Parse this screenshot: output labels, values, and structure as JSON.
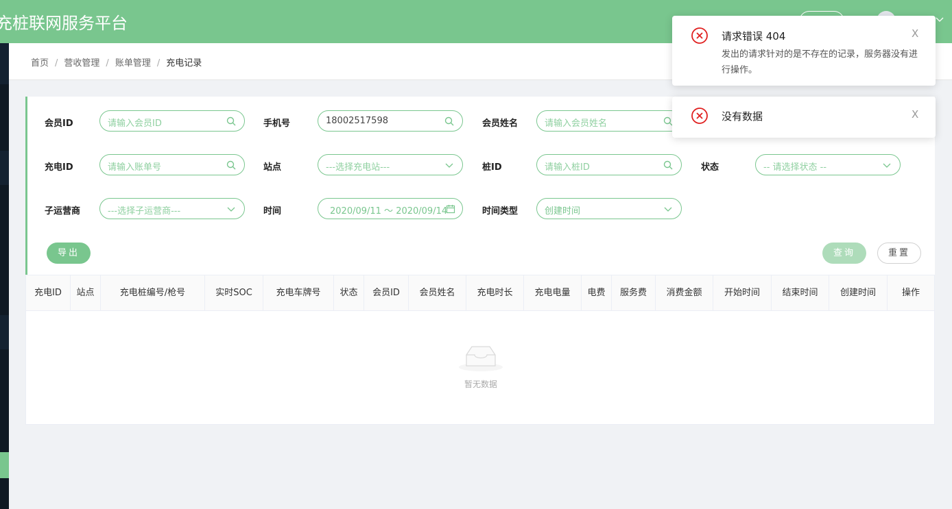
{
  "header": {
    "title": "充桩联网服务平台"
  },
  "breadcrumb": {
    "items": [
      "首页",
      "营收管理",
      "账单管理",
      "充电记录"
    ],
    "separator": "/"
  },
  "filters": {
    "member_id": {
      "label": "会员ID",
      "placeholder": "请输入会员ID"
    },
    "phone": {
      "label": "手机号",
      "value": "18002517598"
    },
    "member_name": {
      "label": "会员姓名",
      "placeholder": "请输入会员姓名"
    },
    "charge_id": {
      "label": "充电ID",
      "placeholder": "请输入账单号"
    },
    "station": {
      "label": "站点",
      "placeholder": "---选择充电站---"
    },
    "pile_id": {
      "label": "桩ID",
      "placeholder": "请输入桩ID"
    },
    "status": {
      "label": "状态",
      "placeholder": "-- 请选择状态 --"
    },
    "sub_operator": {
      "label": "子运营商",
      "placeholder": "---选择子运营商---"
    },
    "time": {
      "label": "时间",
      "value": "2020/09/11 ～ 2020/09/14"
    },
    "time_type": {
      "label": "时间类型",
      "value": "创建时间"
    }
  },
  "buttons": {
    "export": "导出",
    "query": "查询",
    "reset": "重置"
  },
  "table": {
    "columns": [
      "充电ID",
      "站点",
      "充电桩编号/枪号",
      "实时SOC",
      "充电车牌号",
      "状态",
      "会员ID",
      "会员姓名",
      "充电时长",
      "充电电量",
      "电费",
      "服务费",
      "消费金额",
      "开始时间",
      "结束时间",
      "创建时间",
      "操作"
    ],
    "rows": [],
    "empty_text": "暂无数据"
  },
  "notifications": [
    {
      "title": "请求错误 404",
      "body": "发出的请求针对的是不存在的记录，服务器没有进行操作。",
      "close": "X"
    },
    {
      "title": "没有数据",
      "close": "X"
    }
  ],
  "colors": {
    "primary": "#79c68e",
    "error": "#e02020",
    "sidebar": "#0f1923"
  }
}
